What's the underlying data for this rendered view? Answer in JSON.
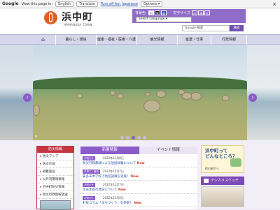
{
  "translate_bar": {
    "google": "Google",
    "view_text": "View this page in:",
    "language": "English",
    "translate_btn": "Translate",
    "turn_off": "Turn off for: Japanese",
    "options": "Options ▾",
    "close": "×"
  },
  "header": {
    "town_name": "浜中町",
    "town_name_en": "HAMANAKA TOWN",
    "bg_color_label": "背景色",
    "text_size_label": "文字サイズ",
    "bg_colors": [
      "白",
      "黒",
      "青"
    ],
    "text_sizes": [
      "小",
      "標",
      "大"
    ],
    "lang_select": "Select Language ▾",
    "search_placeholder": "Google 検索",
    "search_button": "検索"
  },
  "nav": {
    "home_icon": "⌂",
    "items": [
      "暮らし・環境",
      "健康・福祉・医療・介護",
      "観光情報",
      "産業・仕事",
      "行政情報"
    ]
  },
  "hero": {
    "prev": "‹",
    "next": "›",
    "pause": "⏸",
    "slide_count": 5,
    "active_slide": 3
  },
  "left_panel": {
    "heading": "防災情報",
    "items": [
      "防災マップ",
      "防災計画",
      "避難施設",
      "火砕流警報情報",
      "浜中町防災情報",
      "防災行政無線放送"
    ]
  },
  "news": {
    "tab_new": "新着情報",
    "tab_event": "イベント情報",
    "new_badge": "New",
    "items": [
      {
        "category": "お知らせ",
        "date": "2022年12月8日",
        "title": "防災行政無線による放送試験について"
      },
      {
        "category": "子育て・教育",
        "date": "2022年12月7日",
        "title": "霧多布中学校で防犯訓練を実施！"
      },
      {
        "category": "お知らせ",
        "date": "2022年12月7日",
        "title": "年末年始の休日について"
      },
      {
        "category": "お知らせ",
        "date": "2022年12月6日",
        "title": "町長コラム「まちづくり」を更新！"
      }
    ]
  },
  "right_panel": {
    "question_title_1": "浜中町って",
    "question_title_2": "どんなところ？",
    "question_sub": "町の紹介へ",
    "sketch_label": "デジカメスケッチ"
  },
  "colors": {
    "accent_purple": "#8a5bc9",
    "accent_red": "#c53542",
    "logo_orange": "#e06020"
  }
}
